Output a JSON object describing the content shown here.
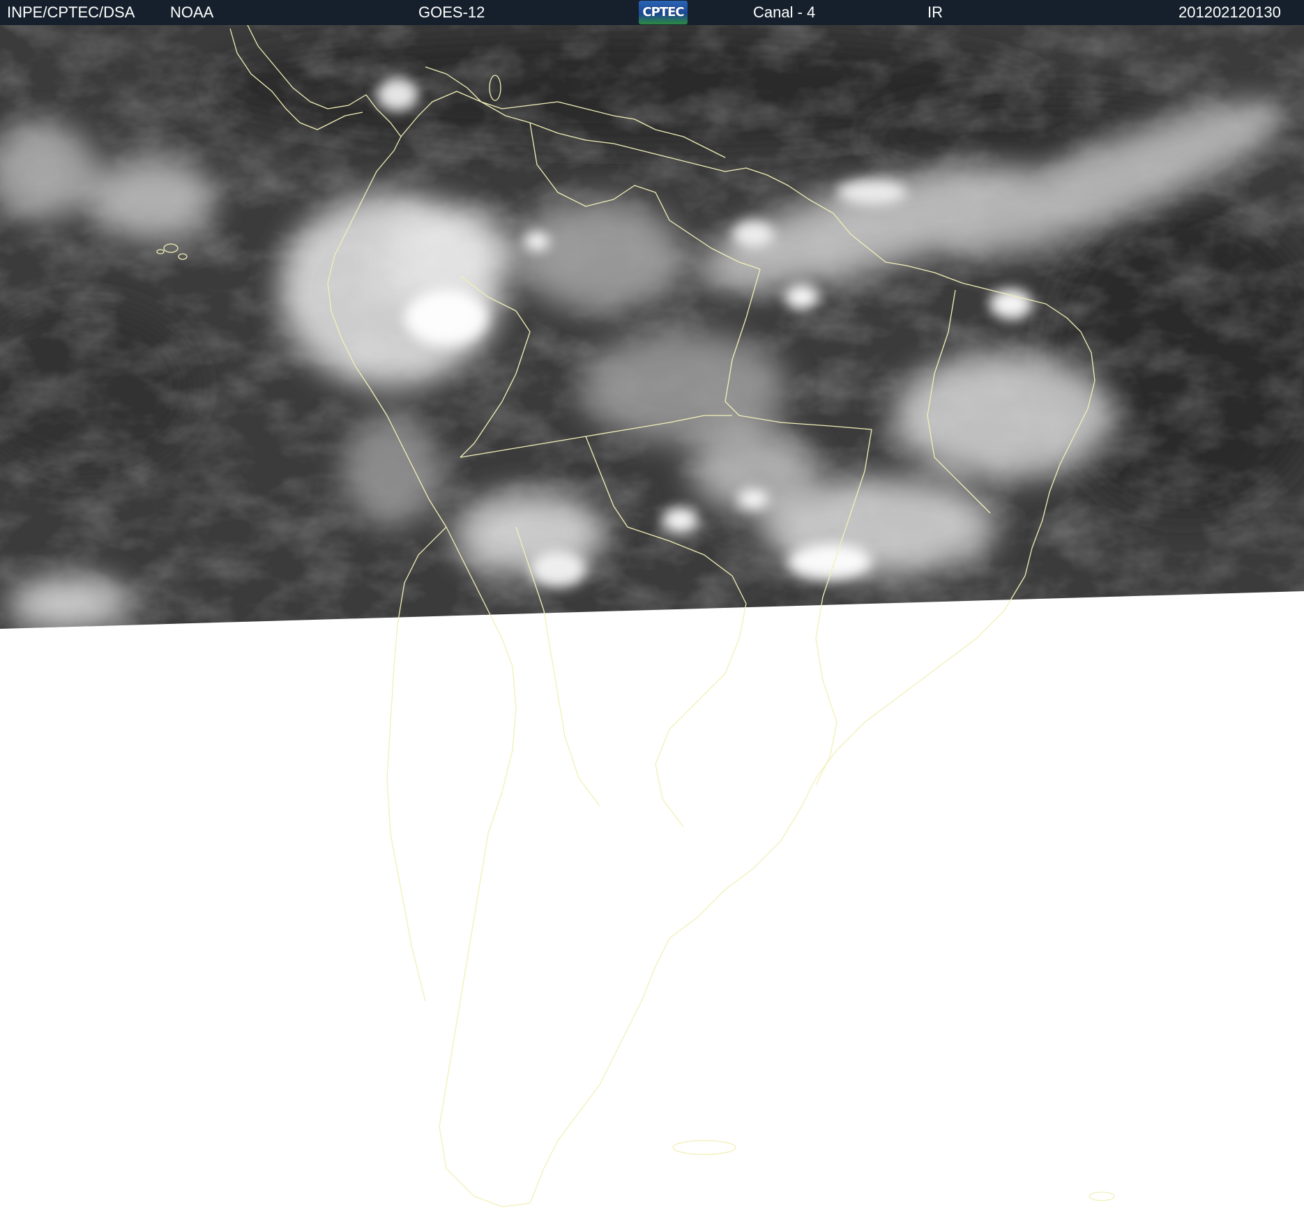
{
  "header": {
    "source": "INPE/CPTEC/DSA",
    "agency": "NOAA",
    "satellite": "GOES-12",
    "logo_text": "CPTEC",
    "channel": "Canal - 4",
    "band": "IR",
    "timestamp": "201202120130"
  },
  "colors": {
    "header_background": "#15202c",
    "header_text": "#ffffff",
    "coastline": "#f2f0b8",
    "ocean_ir": "#3a3a3a",
    "no_data_area": "#ffffff"
  },
  "image": {
    "type": "satellite-infrared",
    "region": "South America"
  }
}
